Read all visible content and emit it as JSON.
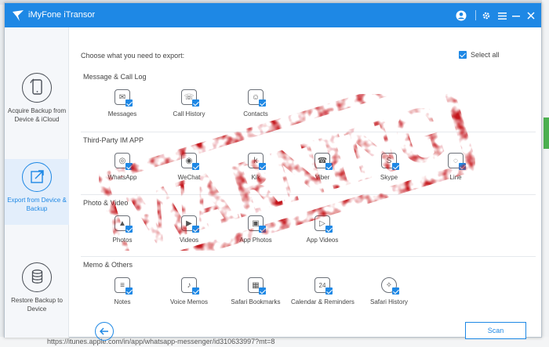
{
  "app": {
    "title": "iMyFone iTransor"
  },
  "background": {
    "url_text": "https://itunes.apple.com/in/app/whatsapp-messenger/id310633997?mt=8"
  },
  "sidebar": {
    "items": [
      {
        "label": "Acquire Backup from Device & iCloud",
        "icon": "phone-icon"
      },
      {
        "label": "Export from Device & Backup",
        "icon": "export-icon"
      },
      {
        "label": "Restore Backup to Device",
        "icon": "database-icon"
      }
    ]
  },
  "main": {
    "prompt": "Choose what you need to export:",
    "select_all": "Select all",
    "sections": [
      {
        "title": "Message & Call Log",
        "items": [
          "Messages",
          "Call History",
          "Contacts"
        ]
      },
      {
        "title": "Third-Party IM APP",
        "items": [
          "WhatsApp",
          "WeChat",
          "Kik",
          "Viber",
          "Skype",
          "Line"
        ]
      },
      {
        "title": "Photo & Video",
        "items": [
          "Photos",
          "Videos",
          "App Photos",
          "App Videos"
        ]
      },
      {
        "title": "Memo & Others",
        "items": [
          "Notes",
          "Voice Memos",
          "Safari Bookmarks",
          "Calendar & Reminders",
          "Safari History"
        ]
      }
    ],
    "scan_label": "Scan"
  },
  "stamp": {
    "text": "WARNING"
  },
  "colors": {
    "accent": "#1e88e5",
    "stamp": "#c4161c"
  }
}
